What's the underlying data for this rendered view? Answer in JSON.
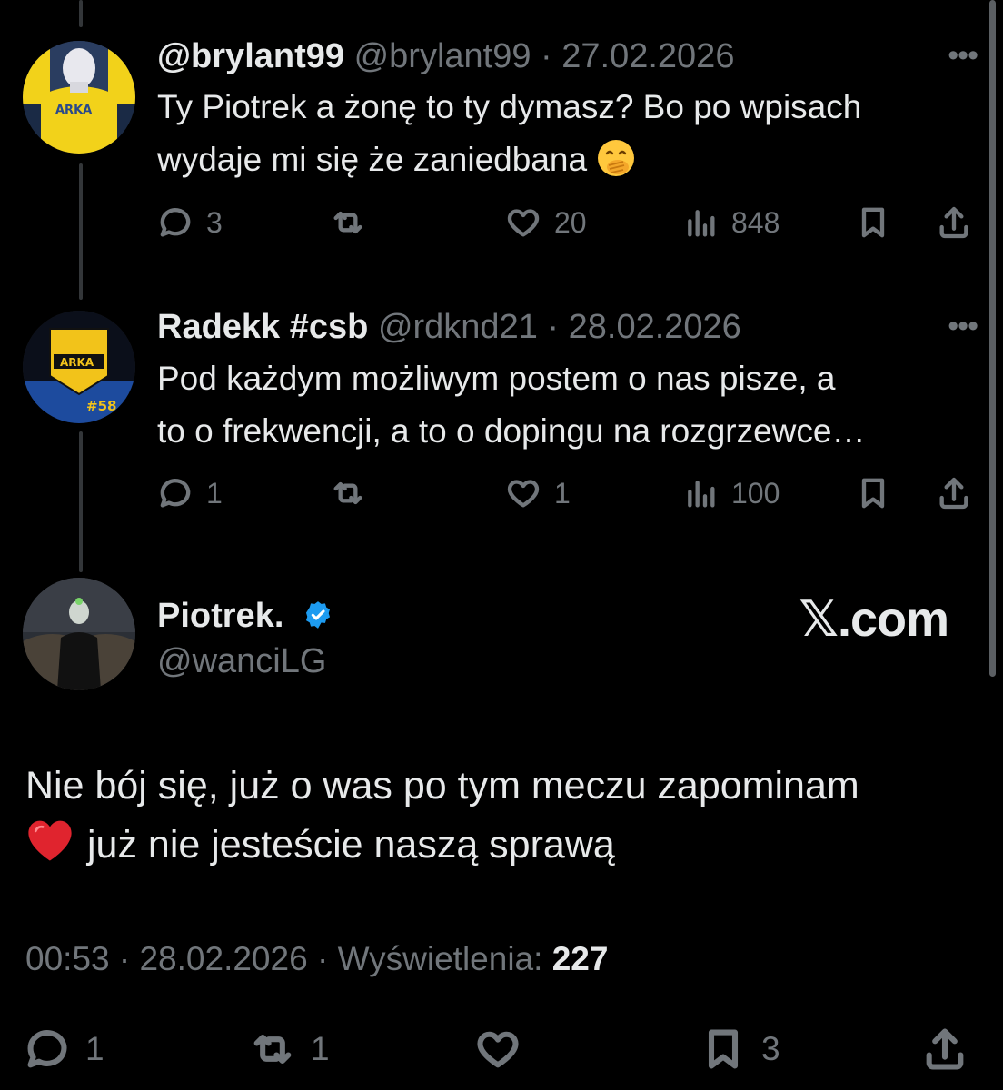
{
  "tweets": [
    {
      "name": "@brylant99",
      "handle": "@brylant99",
      "date": "27.02.2026",
      "text_line1": "Ty Piotrek a żonę to ty dymasz? Bo po wpisach",
      "text_line2": "wydaje mi się że zaniedbana",
      "emoji_icon": "face-with-hand-over-mouth-icon",
      "avatar_text": "ARKA",
      "replies": "3",
      "retweets": "",
      "likes": "20",
      "views": "848"
    },
    {
      "name": "Radekk #csb",
      "handle": "@rdknd21",
      "date": "28.02.2026",
      "text_line1": "Pod każdym możliwym postem o nas pisze, a",
      "text_line2": "to o frekwencji, a to o dopingu na rozgrzewce…",
      "avatar_text": "ARKA",
      "avatar_badge": "#58",
      "replies": "1",
      "retweets": "",
      "likes": "1",
      "views": "100"
    }
  ],
  "main_tweet": {
    "name": "Piotrek.",
    "handle": "@wanciLG",
    "verified_color": "#1d9bf0",
    "text_line1": "Nie bój się, już o was po tym meczu zapominam",
    "text_line2": "już nie jesteście naszą sprawą",
    "heart_emoji_icon": "red-heart-icon",
    "time": "00:53",
    "date": "28.02.2026",
    "views_label": "Wyświetlenia:",
    "views": "227",
    "replies": "1",
    "retweets": "1",
    "likes": "",
    "bookmarks": "3"
  },
  "watermark": "𝕏.com",
  "sep": "·",
  "more": "•••"
}
